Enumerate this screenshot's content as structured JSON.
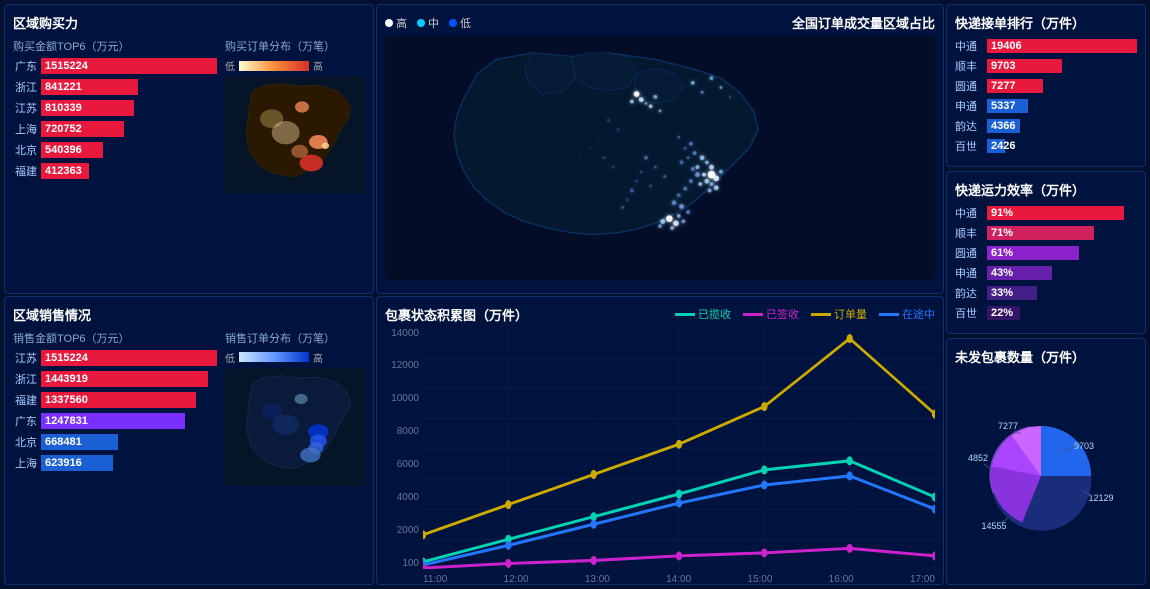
{
  "buying_panel": {
    "title": "区域购买力",
    "subtitle_value": "购买金额TOP6（万元）",
    "subtitle_order": "购买订单分布（万笔）",
    "legend_low": "低",
    "legend_high": "高",
    "bars": [
      {
        "label": "广东",
        "value": "1515224",
        "width_pct": 100,
        "color": "bar-red"
      },
      {
        "label": "浙江",
        "value": "841221",
        "width_pct": 55,
        "color": "bar-red"
      },
      {
        "label": "江苏",
        "value": "810339",
        "width_pct": 53,
        "color": "bar-red"
      },
      {
        "label": "上海",
        "value": "720752",
        "width_pct": 47,
        "color": "bar-red"
      },
      {
        "label": "北京",
        "value": "540396",
        "width_pct": 35,
        "color": "bar-red"
      },
      {
        "label": "福建",
        "value": "412363",
        "width_pct": 27,
        "color": "bar-red"
      }
    ]
  },
  "selling_panel": {
    "title": "区域销售情况",
    "subtitle_value": "销售金额TOP6（万元）",
    "subtitle_order": "销售订单分布（万笔）",
    "legend_low": "低",
    "legend_high": "高",
    "bars": [
      {
        "label": "江苏",
        "value": "1515224",
        "width_pct": 100,
        "color": "bar-red"
      },
      {
        "label": "浙江",
        "value": "1443919",
        "width_pct": 95,
        "color": "bar-red"
      },
      {
        "label": "福建",
        "value": "1337560",
        "width_pct": 88,
        "color": "bar-red"
      },
      {
        "label": "广东",
        "value": "1247831",
        "width_pct": 82,
        "color": "bar-purple"
      },
      {
        "label": "北京",
        "value": "668481",
        "width_pct": 44,
        "color": "bar-blue"
      },
      {
        "label": "上海",
        "value": "623916",
        "width_pct": 41,
        "color": "bar-blue"
      }
    ]
  },
  "map_panel": {
    "title": "全国订单成交量区域占比",
    "legend_high": "高",
    "legend_mid": "中",
    "legend_low": "低"
  },
  "ranking_panel": {
    "title": "快递接单排行（万件）",
    "items": [
      {
        "label": "中通",
        "value": "19406",
        "width_pct": 100,
        "color": "rank-bar-red"
      },
      {
        "label": "顺丰",
        "value": "9703",
        "width_pct": 50,
        "color": "rank-bar-red"
      },
      {
        "label": "圆通",
        "value": "7277",
        "width_pct": 37,
        "color": "rank-bar-red"
      },
      {
        "label": "申通",
        "value": "5337",
        "width_pct": 27,
        "color": "rank-bar-blue"
      },
      {
        "label": "韵达",
        "value": "4366",
        "width_pct": 22,
        "color": "rank-bar-blue"
      },
      {
        "label": "百世",
        "value": "2426",
        "width_pct": 12,
        "color": "rank-bar-blue"
      }
    ]
  },
  "efficiency_panel": {
    "title": "快递运力效率（万件）",
    "items": [
      {
        "label": "中通",
        "value": "91%",
        "width_pct": 91,
        "color": "eff-red"
      },
      {
        "label": "顺丰",
        "value": "71%",
        "width_pct": 71,
        "color": "eff-pink"
      },
      {
        "label": "圆通",
        "value": "61%",
        "width_pct": 61,
        "color": "eff-purple"
      },
      {
        "label": "申通",
        "value": "43%",
        "width_pct": 43,
        "color": "eff-darkpurple"
      },
      {
        "label": "韵达",
        "value": "33%",
        "width_pct": 33,
        "color": "eff-darkblue"
      },
      {
        "label": "百世",
        "value": "22%",
        "width_pct": 22,
        "color": "eff-navy"
      }
    ]
  },
  "chart_panel": {
    "title": "包裹状态积累图（万件）",
    "legend": [
      {
        "label": "已揽收",
        "color": "#00d4b4"
      },
      {
        "label": "已签收",
        "color": "#cc22cc"
      },
      {
        "label": "订单量",
        "color": "#ccaa00"
      },
      {
        "label": "在途中",
        "color": "#2277ff"
      }
    ],
    "y_labels": [
      "14000",
      "12000",
      "10000",
      "8000",
      "6000",
      "4000",
      "2000",
      "100"
    ],
    "x_labels": [
      "11:00",
      "12:00",
      "13:00",
      "14:00",
      "15:00",
      "16:00",
      "17:00"
    ]
  },
  "unshipped_panel": {
    "title": "未发包裹数量（万件）",
    "segments": [
      {
        "label": "9703",
        "color": "#1a6fd4",
        "pct": 25
      },
      {
        "label": "12129",
        "color": "#2244aa",
        "pct": 31
      },
      {
        "label": "14555",
        "color": "#7744cc",
        "pct": 22
      },
      {
        "label": "4852",
        "color": "#9922ee",
        "pct": 12
      },
      {
        "label": "7277",
        "color": "#cc44ff",
        "pct": 10
      }
    ]
  }
}
